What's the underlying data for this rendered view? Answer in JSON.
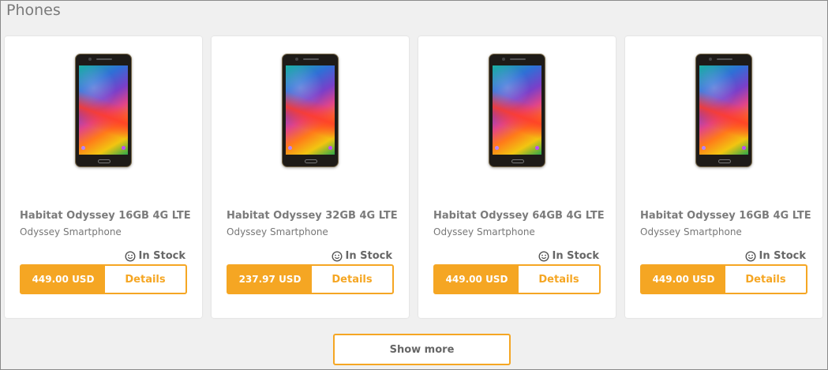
{
  "section": {
    "title": "Phones"
  },
  "colors": {
    "accent": "#f5a623",
    "background": "#f0f0f0",
    "card": "#ffffff"
  },
  "products": [
    {
      "name": "Habitat Odyssey 16GB 4G LTE",
      "subtitle": "Odyssey Smartphone",
      "stock": "In Stock",
      "stock_icon": "smiley-icon",
      "price": "449.00 USD",
      "details_label": "Details",
      "image": "phone-image"
    },
    {
      "name": "Habitat Odyssey 32GB 4G LTE",
      "subtitle": "Odyssey Smartphone",
      "stock": "In Stock",
      "stock_icon": "smiley-icon",
      "price": "237.97 USD",
      "details_label": "Details",
      "image": "phone-image"
    },
    {
      "name": "Habitat Odyssey 64GB 4G LTE",
      "subtitle": "Odyssey Smartphone",
      "stock": "In Stock",
      "stock_icon": "smiley-icon",
      "price": "449.00 USD",
      "details_label": "Details",
      "image": "phone-image"
    },
    {
      "name": "Habitat Odyssey 16GB 4G LTE",
      "subtitle": "Odyssey Smartphone",
      "stock": "In Stock",
      "stock_icon": "smiley-icon",
      "price": "449.00 USD",
      "details_label": "Details",
      "image": "phone-image"
    }
  ],
  "show_more_label": "Show more"
}
